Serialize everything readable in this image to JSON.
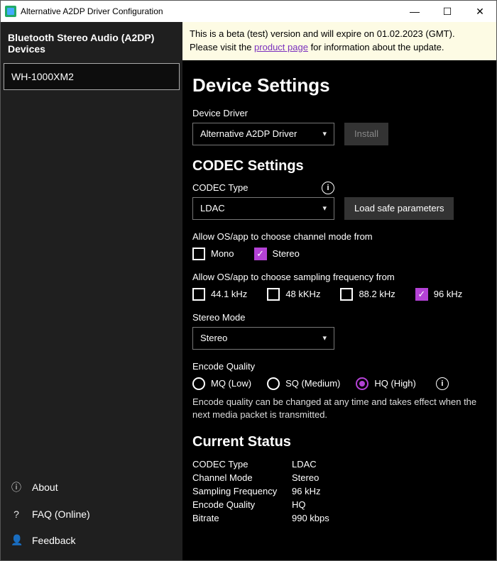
{
  "titlebar": {
    "title": "Alternative A2DP Driver Configuration"
  },
  "sidebar": {
    "header": "Bluetooth Stereo Audio (A2DP) Devices",
    "device": "WH-1000XM2",
    "links": {
      "about": "About",
      "faq": "FAQ (Online)",
      "feedback": "Feedback"
    }
  },
  "banner": {
    "line1": "This is a beta (test) version and will expire on 01.02.2023 (GMT).",
    "line2a": "Please visit the ",
    "link": "product page",
    "line2b": " for information about the update."
  },
  "headings": {
    "device_settings": "Device Settings",
    "codec_settings": "CODEC Settings",
    "current_status": "Current Status"
  },
  "labels": {
    "device_driver": "Device Driver",
    "codec_type": "CODEC Type",
    "channel_mode": "Allow OS/app to choose channel mode from",
    "sampling_from": "Allow OS/app to choose sampling frequency from",
    "stereo_mode": "Stereo Mode",
    "encode_quality": "Encode Quality"
  },
  "buttons": {
    "install": "Install",
    "load_safe": "Load safe parameters"
  },
  "selects": {
    "driver": "Alternative A2DP Driver",
    "codec": "LDAC",
    "stereo_mode": "Stereo"
  },
  "channel_mode": {
    "mono": "Mono",
    "stereo": "Stereo"
  },
  "sampling": {
    "s44": "44.1 kHz",
    "s48": "48 kKHz",
    "s88": "88.2 kHz",
    "s96": "96 kHz"
  },
  "encode": {
    "mq": "MQ (Low)",
    "sq": "SQ (Medium)",
    "hq": "HQ (High)",
    "hint": "Encode quality can be changed at any time and takes effect when the next media packet is transmitted."
  },
  "status": {
    "codec_type_k": "CODEC Type",
    "codec_type_v": "LDAC",
    "channel_mode_k": "Channel Mode",
    "channel_mode_v": "Stereo",
    "sampling_k": "Sampling Frequency",
    "sampling_v": "96 kHz",
    "encode_k": "Encode Quality",
    "encode_v": "HQ",
    "bitrate_k": "Bitrate",
    "bitrate_v": "990 kbps"
  }
}
